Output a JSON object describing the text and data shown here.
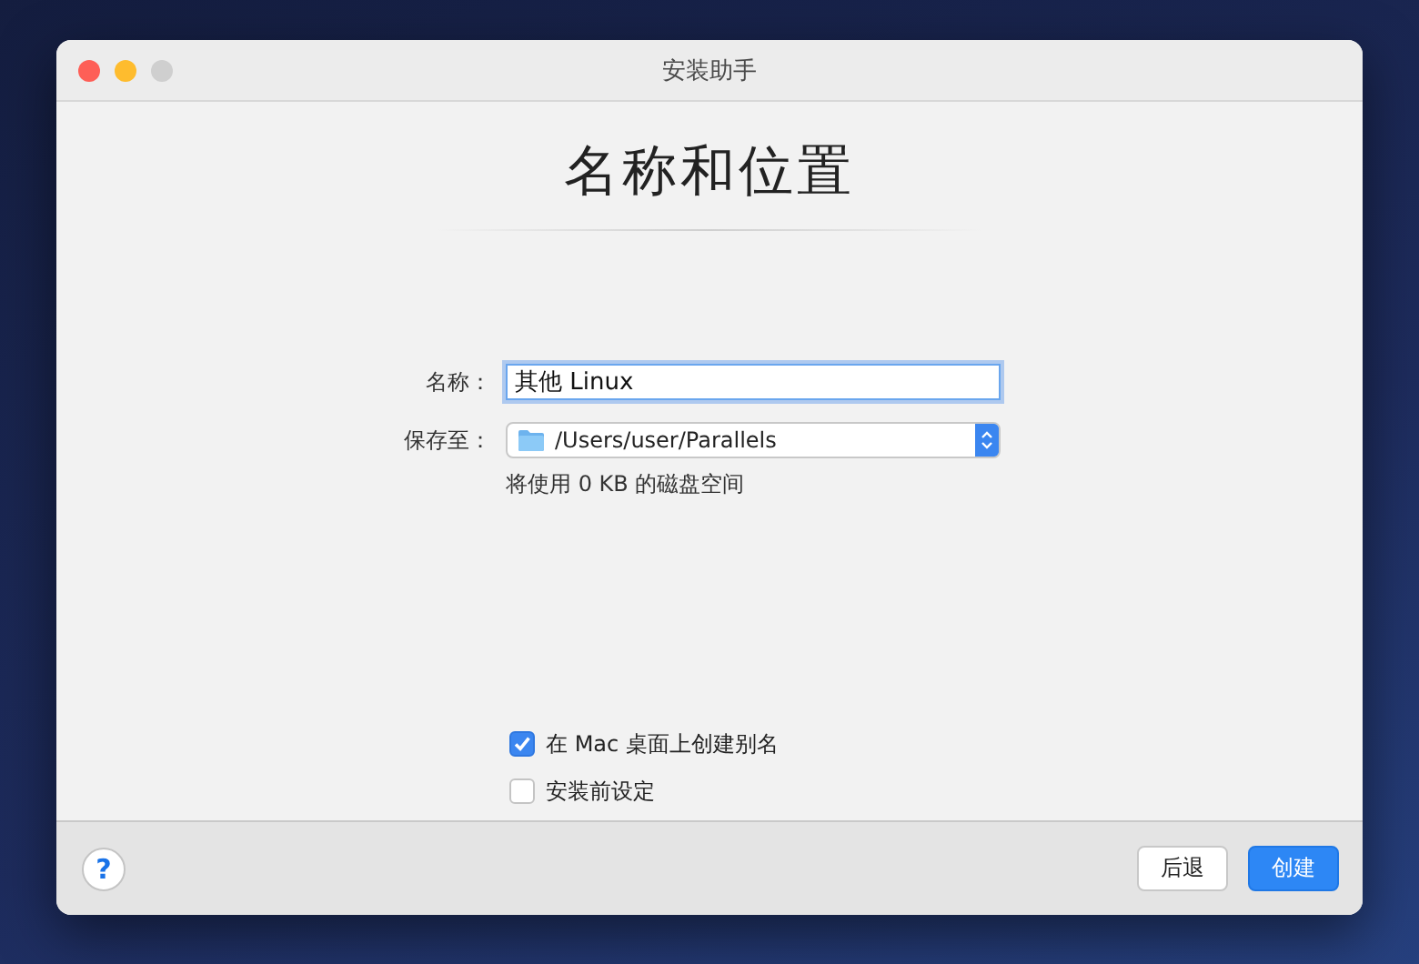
{
  "window": {
    "title": "安装助手"
  },
  "heading": "名称和位置",
  "fields": [
    {
      "kind": "text",
      "label": "名称：",
      "value": "其他 Linux",
      "focused": true
    },
    {
      "kind": "select",
      "label": "保存至：",
      "value": "/Users/user/Parallels",
      "focused": false
    }
  ],
  "note": "将使用 0 KB 的磁盘空间",
  "options": [
    {
      "label": "在 Mac 桌面上创建别名",
      "checked": true
    },
    {
      "label": "安装前设定",
      "checked": false
    }
  ],
  "footer": {
    "help": "?",
    "buttons": [
      {
        "label": "后退",
        "kind": "secondary"
      },
      {
        "label": "创建",
        "kind": "primary"
      }
    ]
  }
}
